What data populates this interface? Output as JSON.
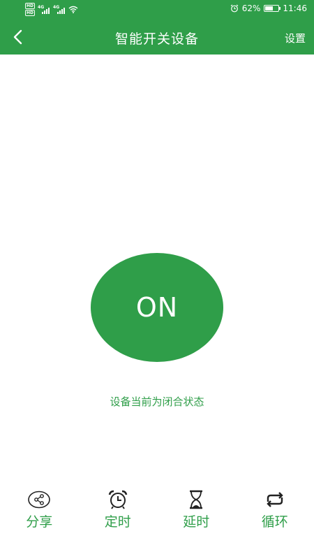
{
  "status_bar": {
    "network_label_1": "4G",
    "network_label_2": "4G",
    "hd_label": "HD",
    "battery_percent": "62%",
    "battery_level": 0.62,
    "time": "11:46"
  },
  "header": {
    "title": "智能开关设备",
    "settings_label": "设置",
    "color": "#2f9e49"
  },
  "main": {
    "switch_label": "ON",
    "status_text": "设备当前为闭合状态",
    "accent_color": "#2f9e49"
  },
  "bottom_actions": [
    {
      "icon": "share-icon",
      "label": "分享"
    },
    {
      "icon": "alarm-clock-icon",
      "label": "定时"
    },
    {
      "icon": "hourglass-icon",
      "label": "延时"
    },
    {
      "icon": "repeat-icon",
      "label": "循环"
    }
  ]
}
